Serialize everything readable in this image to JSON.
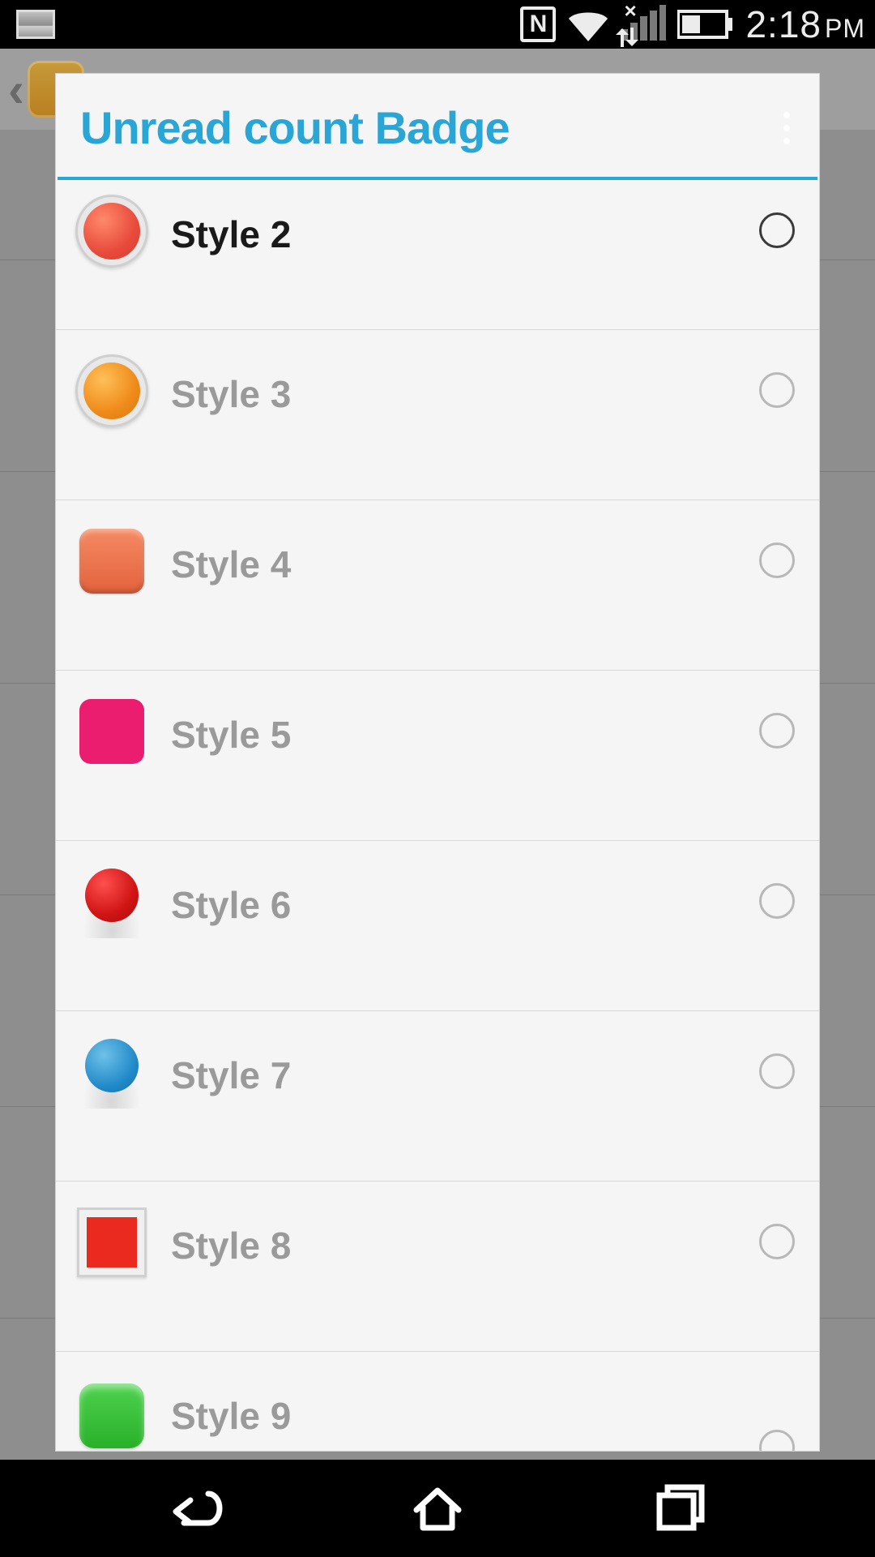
{
  "status_bar": {
    "time": "2:18",
    "ampm": "PM"
  },
  "dialog": {
    "title": "Unread count Badge",
    "options": [
      {
        "label": "Style 2",
        "highlight": true
      },
      {
        "label": "Style 3",
        "highlight": false
      },
      {
        "label": "Style 4",
        "highlight": false
      },
      {
        "label": "Style 5",
        "highlight": false
      },
      {
        "label": "Style 6",
        "highlight": false
      },
      {
        "label": "Style 7",
        "highlight": false
      },
      {
        "label": "Style 8",
        "highlight": false
      },
      {
        "label": "Style 9",
        "highlight": false
      }
    ]
  }
}
